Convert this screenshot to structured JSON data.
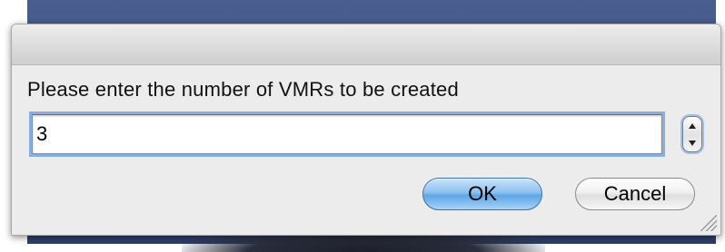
{
  "dialog": {
    "prompt": "Please enter the number of VMRs to be created",
    "input": {
      "value": "3",
      "placeholder": ""
    },
    "stepper": {
      "up_icon": "triangle-up-icon",
      "down_icon": "triangle-down-icon"
    },
    "buttons": {
      "ok_label": "OK",
      "cancel_label": "Cancel"
    }
  },
  "colors": {
    "desktop": "#3d5283",
    "dialog_bg": "#ececec",
    "focus_ring": "#86aee5",
    "default_button": "#5ea6e6"
  }
}
